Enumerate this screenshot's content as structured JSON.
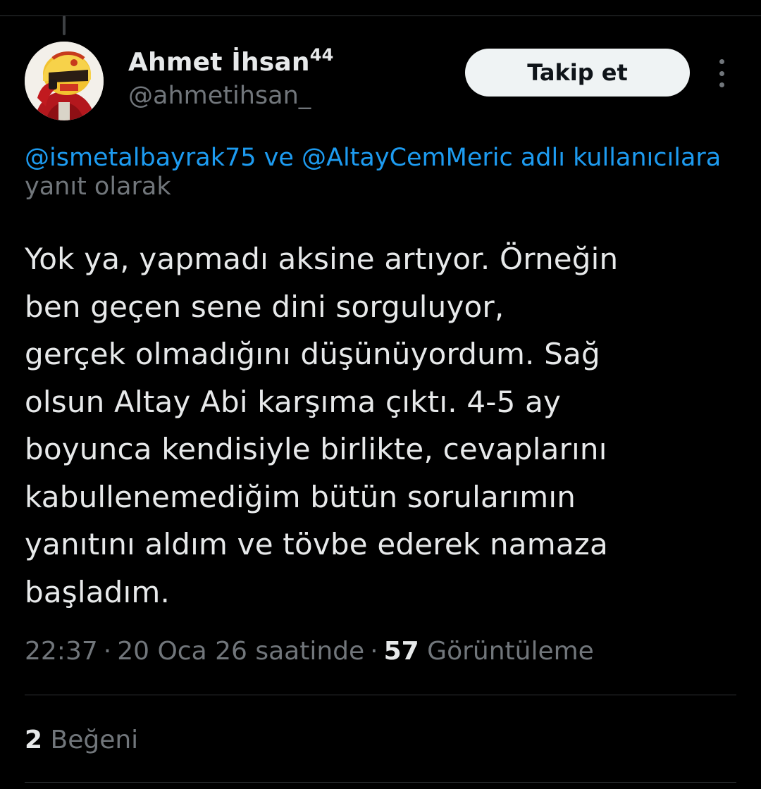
{
  "colors": {
    "background": "#000000",
    "text_primary": "#e7e9ea",
    "text_secondary": "#71767b",
    "link": "#1d9bf0",
    "follow_button_bg": "#eff3f4",
    "follow_button_text": "#0f1419",
    "divider": "#2f3336"
  },
  "author": {
    "display_name": "Ahmet İhsan",
    "display_name_suffix": "44",
    "handle": "@ahmetihsan_",
    "avatar_icon": "avatar-image"
  },
  "actions": {
    "follow_label": "Takip et",
    "more_icon": "more-vertical-icon"
  },
  "reply_context": {
    "mention_1": "@ismetalbayrak75",
    "connector": " ve ",
    "mention_2": "@AltayCemMeric",
    "suffix": " adlı kullanıcılara",
    "line_2": "yanıt olarak"
  },
  "tweet": {
    "lines": [
      "Yok ya, yapmadı aksine artıyor. Örneğin",
      "ben geçen sene dini sorguluyor,",
      "gerçek olmadığını düşünüyordum. Sağ",
      "olsun Altay Abi karşıma çıktı. 4-5 ay",
      "boyunca kendisiyle birlikte, cevaplarını",
      "kabullenemediğim bütün sorularımın",
      "yanıtını aldım ve tövbe ederek namaza",
      "başladım."
    ]
  },
  "meta": {
    "time": "22:37",
    "separator": "·",
    "date": "20 Oca 26 saatinde",
    "views_count": "57",
    "views_label": "Görüntüleme"
  },
  "engagement": {
    "likes_count": "2",
    "likes_label": "Beğeni"
  }
}
